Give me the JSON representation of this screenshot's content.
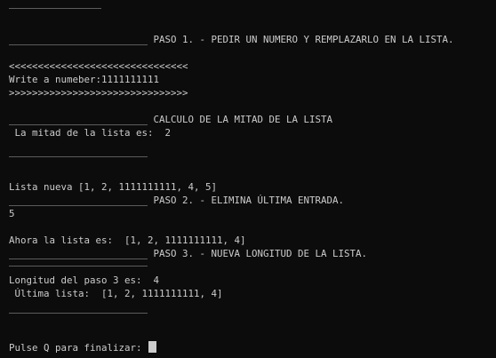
{
  "terminal": {
    "lines": [
      "________________",
      "________________________ PASO 1. - PEDIR UN NUMERO Y REMPLAZARLO EN LA LISTA.",
      "<<<<<<<<<<<<<<<<<<<<<<<<<<<<<<<",
      "Write a numeber:1111111111",
      ">>>>>>>>>>>>>>>>>>>>>>>>>>>>>>>",
      "________________________ CALCULO DE LA MITAD DE LA LISTA",
      " La mitad de la lista es:  2",
      "________________________",
      "Lista nueva [1, 2, 1111111111, 4, 5]",
      "________________________ PASO 2. - ELIMINA ÚLTIMA ENTRADA.",
      "5",
      "Ahora la lista es:  [1, 2, 1111111111, 4]",
      "________________________ PASO 3. - NUEVA LONGITUD DE LA LISTA.",
      "________________________",
      "Longitud del paso 3 es:  4",
      " Última lista:  [1, 2, 1111111111, 4]",
      "________________________",
      "Pulse Q para finalizar: "
    ]
  }
}
